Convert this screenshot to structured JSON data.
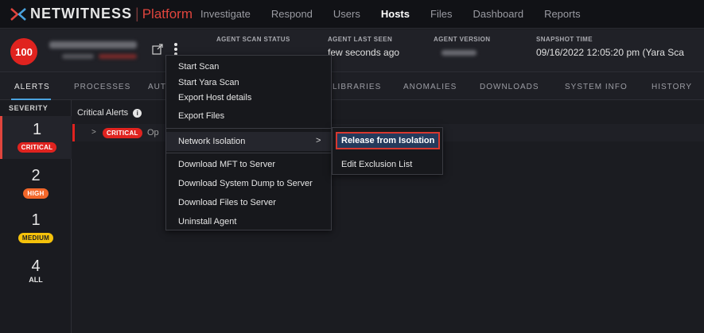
{
  "brand": {
    "name": "NETWITNESS",
    "separator": "|",
    "product": "Platform",
    "accent": "#e0453d"
  },
  "nav": {
    "items": [
      "Investigate",
      "Respond",
      "Users",
      "Hosts",
      "Files",
      "Dashboard",
      "Reports"
    ],
    "active": "Hosts"
  },
  "host": {
    "risk_score": "100",
    "risk_color": "#e0231f",
    "meta": [
      {
        "label": "AGENT SCAN STATUS",
        "value": ""
      },
      {
        "label": "AGENT LAST SEEN",
        "value": "few seconds ago"
      },
      {
        "label": "AGENT VERSION",
        "value": ""
      },
      {
        "label": "SNAPSHOT TIME",
        "value": "09/16/2022 12:05:20 pm (Yara Sca"
      }
    ]
  },
  "tabs": [
    "ALERTS",
    "PROCESSES",
    "AUT",
    "LIBRARIES",
    "ANOMALIES",
    "DOWNLOADS",
    "SYSTEM INFO",
    "HISTORY"
  ],
  "tabs_active": "ALERTS",
  "sidebar": {
    "title": "SEVERITY",
    "levels": [
      {
        "count": "1",
        "label": "CRITICAL",
        "color": "#e0231f"
      },
      {
        "count": "2",
        "label": "HIGH",
        "color": "#f2672a"
      },
      {
        "count": "1",
        "label": "MEDIUM",
        "color": "#f5c20b"
      },
      {
        "count": "4",
        "label": "ALL"
      }
    ]
  },
  "main": {
    "header": "Critical Alerts",
    "info_icon": "info-icon",
    "row": {
      "severity": "CRITICAL",
      "text": "Op"
    }
  },
  "menu": {
    "items": [
      "Start Scan",
      "Start Yara Scan",
      "Export Host details",
      "Export Files",
      "Network Isolation",
      "Download MFT to Server",
      "Download System Dump to Server",
      "Download Files to Server",
      "Uninstall Agent"
    ],
    "submenu": [
      "Release from Isolation",
      "Edit Exclusion List"
    ]
  }
}
